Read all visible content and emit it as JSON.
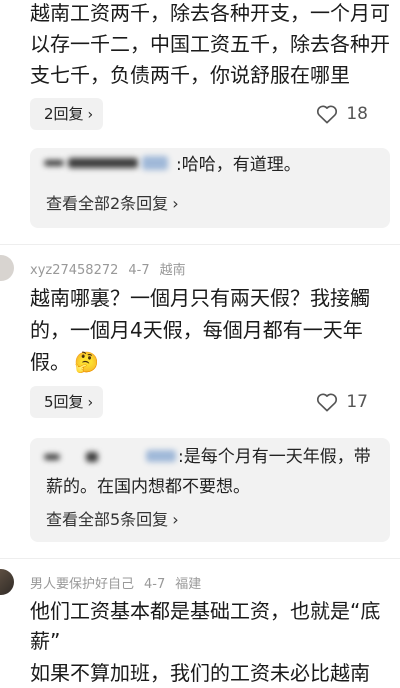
{
  "comment1": {
    "lines": [
      "越南工资两千，除去各种开支，一个月可",
      "以存一千二，中国工资五千，除去各种开",
      "支七千，负债两千，你说舒服在哪里"
    ],
    "reply_count": "2回复",
    "likes": "18",
    "sub_reply": ":哈哈，有道理。",
    "view_all": "查看全部2条回复"
  },
  "comment2": {
    "username": "xyz27458272",
    "date": "4-7",
    "location": "越南",
    "lines": [
      "越南哪裏？一個月只有兩天假？我接觸",
      "的，一個月4天假，每個月都有一天年",
      "假。"
    ],
    "reply_count": "5回复",
    "likes": "17",
    "sub_reply_lines": [
      ":是每个月有一天年假，带",
      "薪的。在国内想都不要想。"
    ],
    "view_all": "查看全部5条回复"
  },
  "comment3": {
    "username": "男人要保护好自己",
    "date": "4-7",
    "location": "福建",
    "lines": [
      "他们工资基本都是基础工资，也就是“底",
      "薪”",
      "如果不算加班，我们的工资未必比越南"
    ]
  },
  "icons": {
    "chevron": "›",
    "thinking_emoji": "🤔"
  },
  "colors": {
    "meta": "#999999",
    "subbox": "#f2f2f2",
    "pill": "#f1f1f1"
  }
}
